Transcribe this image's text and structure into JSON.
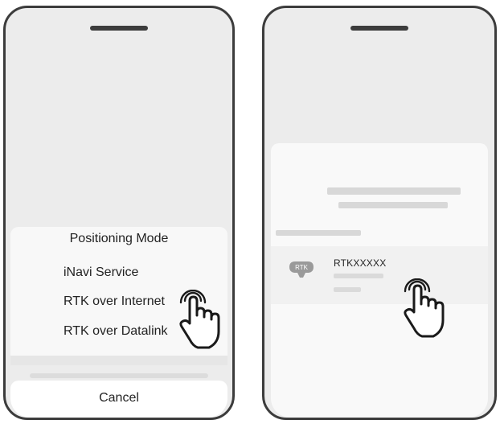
{
  "left_screen": {
    "sheet_title": "Positioning Mode",
    "options": [
      "iNavi Service",
      "RTK over Internet",
      "RTK over Datalink"
    ],
    "cancel_label": "Cancel"
  },
  "right_screen": {
    "device": {
      "name": "RTKXXXXX",
      "icon_label": "RTK"
    }
  }
}
